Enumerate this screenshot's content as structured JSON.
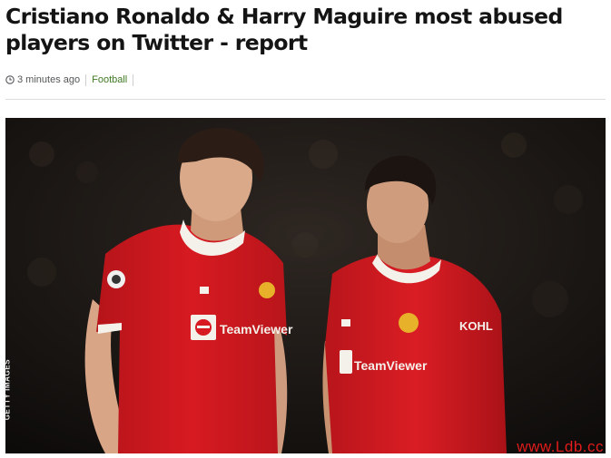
{
  "article": {
    "headline": "Cristiano Ronaldo & Harry Maguire most abused players on Twitter - report",
    "timestamp": "3 minutes ago",
    "topic": "Football"
  },
  "image": {
    "credit": "GETTY IMAGES",
    "sponsor_text": "TeamViewer",
    "shirt_brand": "KOHL",
    "watermark": "www.Ldb.cc"
  },
  "colors": {
    "topic": "#3f7a24",
    "shirt": "#d71a21",
    "watermark": "#e01b1b"
  }
}
